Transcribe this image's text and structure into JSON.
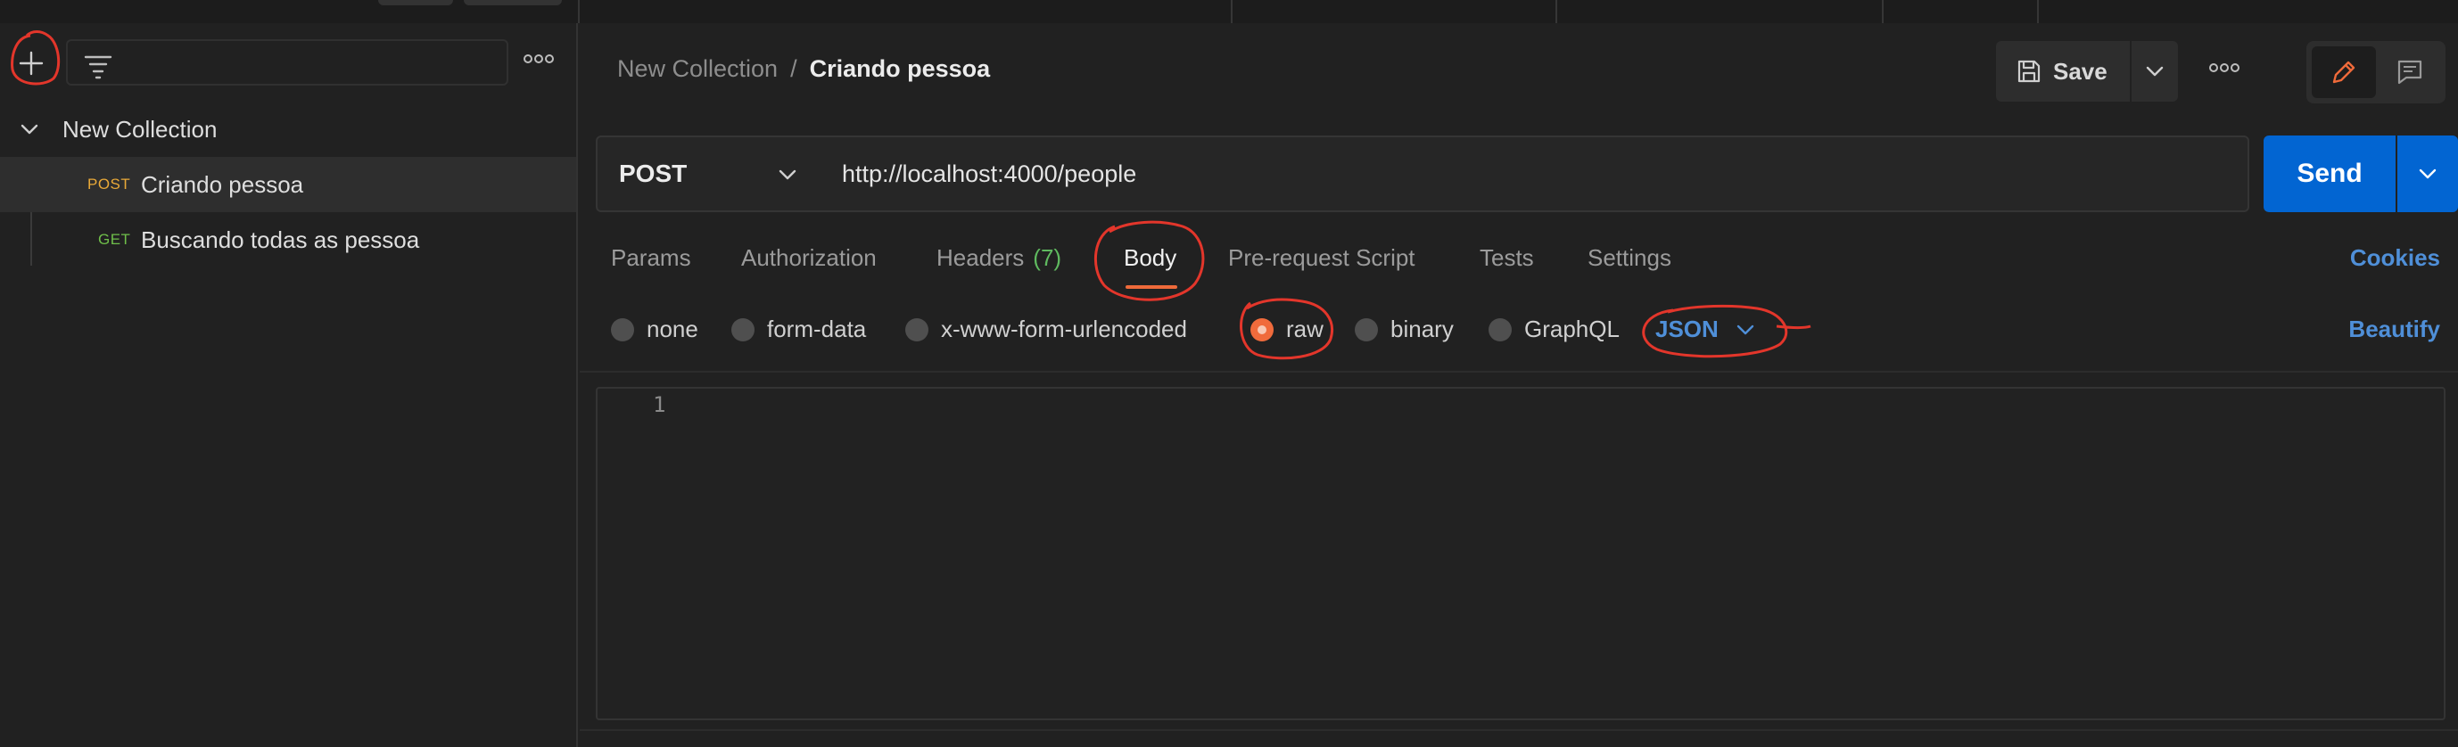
{
  "sidebar": {
    "search_placeholder": "",
    "tree": {
      "collection_label": "New Collection",
      "requests": [
        {
          "method": "POST",
          "name": "Criando pessoa"
        },
        {
          "method": "GET",
          "name": "Buscando todas as pessoa"
        }
      ]
    }
  },
  "header": {
    "breadcrumb_collection": "New Collection",
    "breadcrumb_separator": "/",
    "breadcrumb_request": "Criando pessoa",
    "save_label": "Save"
  },
  "request": {
    "method": "POST",
    "url": "http://localhost:4000/people",
    "send_label": "Send"
  },
  "tabs": {
    "params": "Params",
    "authorization": "Authorization",
    "headers": "Headers",
    "headers_count": "(7)",
    "body": "Body",
    "prerequest": "Pre-request Script",
    "tests": "Tests",
    "settings": "Settings",
    "active": "Body"
  },
  "cookies_label": "Cookies",
  "body_types": {
    "none": "none",
    "form_data": "form-data",
    "urlencoded": "x-www-form-urlencoded",
    "raw": "raw",
    "binary": "binary",
    "graphql": "GraphQL",
    "selected": "raw"
  },
  "raw_language": "JSON",
  "beautify_label": "Beautify",
  "editor": {
    "line_numbers": [
      "1"
    ],
    "content": ""
  },
  "colors": {
    "accent_blue": "#0265d2",
    "link_blue": "#4f8fd8",
    "post_method": "#e9a938",
    "get_method": "#6fbf4a",
    "active_tab_underline": "#ef6a3a",
    "annotation_red": "#e3362b"
  },
  "icons": {
    "new": "plus-icon",
    "filter": "filter-icon",
    "more": "more-horizontal-icon",
    "save": "floppy-disk-icon",
    "edit": "pencil-icon",
    "comments": "comment-icon",
    "chevron": "chevron-down-icon"
  }
}
